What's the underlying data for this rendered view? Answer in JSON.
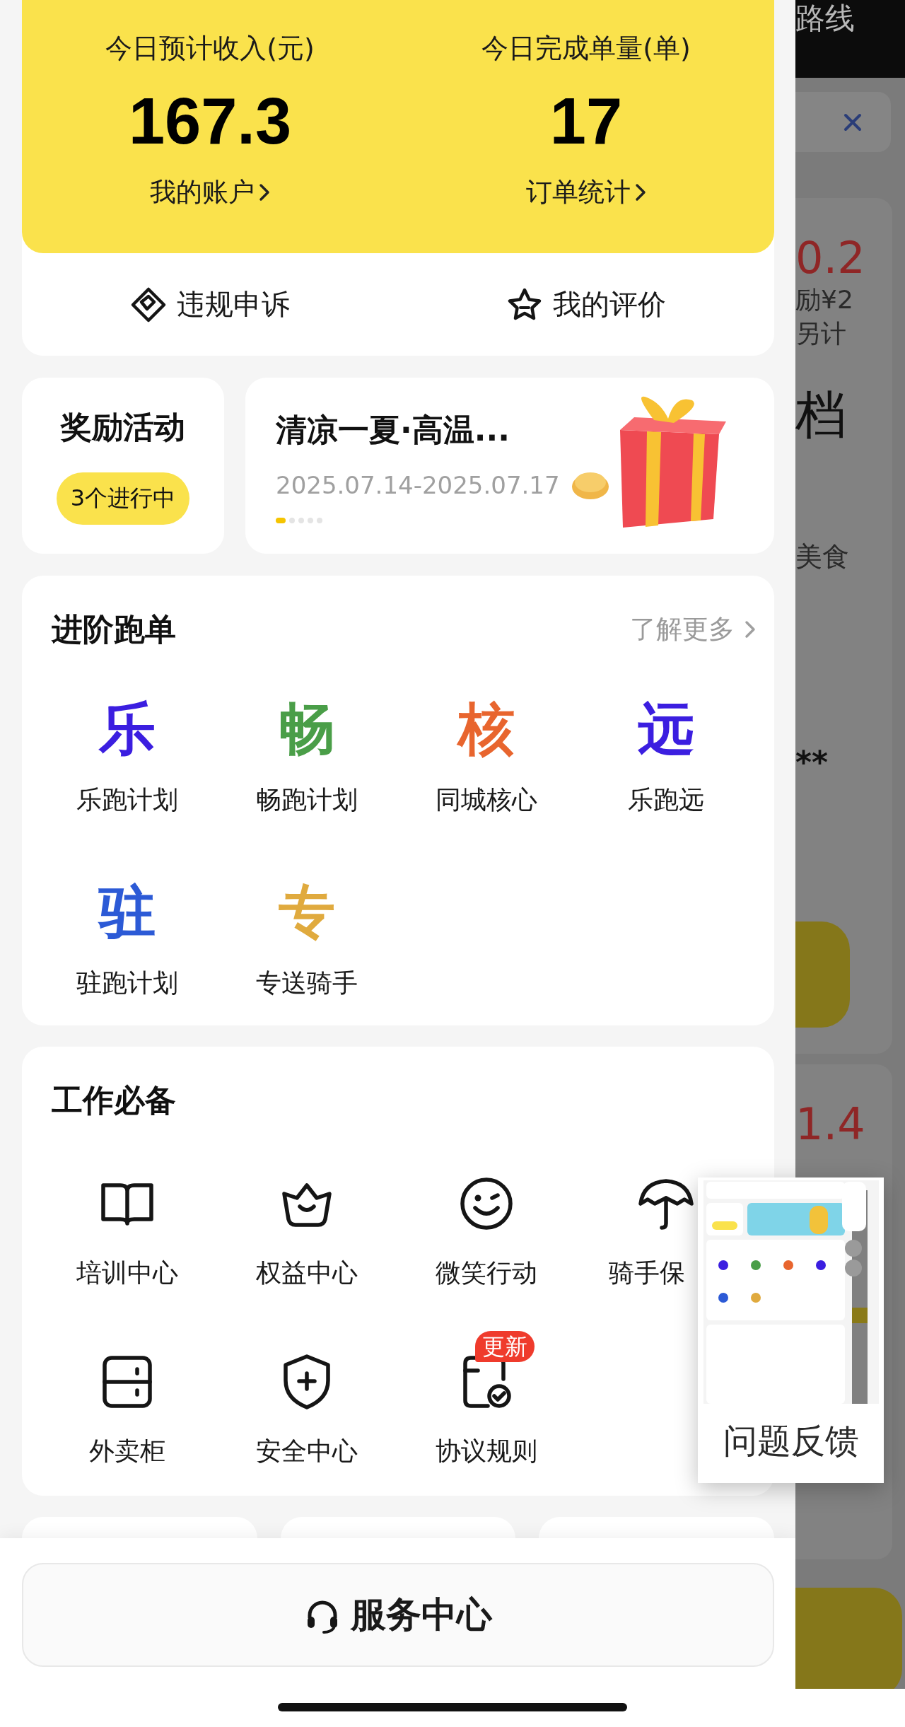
{
  "income_card": {
    "stats": [
      {
        "label": "今日预计收入(元)",
        "value": "167.3",
        "link": "我的账户"
      },
      {
        "label": "今日完成单量(单)",
        "value": "17",
        "link": "订单统计"
      }
    ]
  },
  "actions": [
    {
      "kind": "appeal",
      "label": "违规申诉"
    },
    {
      "kind": "rating",
      "label": "我的评价"
    }
  ],
  "rewards": {
    "title": "奖励活动",
    "badge": "3个进行中"
  },
  "banner": {
    "title": "清凉一夏·高温...",
    "dates": "2025.07.14-2025.07.17",
    "dots": [
      {
        "selected": true
      },
      {
        "selected": false
      },
      {
        "selected": false
      },
      {
        "selected": false
      },
      {
        "selected": false
      }
    ]
  },
  "advanced": {
    "title": "进阶跑单",
    "more": "了解更多",
    "items": [
      {
        "glyph": "乐",
        "color": "#3b1ee0",
        "label": "乐跑计划"
      },
      {
        "glyph": "畅",
        "color": "#4a9e48",
        "label": "畅跑计划"
      },
      {
        "glyph": "核",
        "color": "#e8652e",
        "label": "同城核心"
      },
      {
        "glyph": "远",
        "color": "#3b1ee0",
        "label": "乐跑远"
      },
      {
        "glyph": "驻",
        "color": "#2c5ad6",
        "label": "驻跑计划"
      },
      {
        "glyph": "专",
        "color": "#e0aa3e",
        "label": "专送骑手"
      }
    ]
  },
  "essentials": {
    "title": "工作必备",
    "items": [
      {
        "kind": "book",
        "label": "培训中心"
      },
      {
        "kind": "crown",
        "label": "权益中心"
      },
      {
        "kind": "smile",
        "label": "微笑行动"
      },
      {
        "kind": "umbrella",
        "label": "骑手保"
      },
      {
        "kind": "cabinet",
        "label": "外卖柜"
      },
      {
        "kind": "shield",
        "label": "安全中心"
      },
      {
        "kind": "document",
        "label": "协议规则",
        "badge": "更新"
      }
    ]
  },
  "service_button": {
    "label": "服务中心"
  },
  "background_page": {
    "title": "路线",
    "cards": [
      {
        "amount": "0.2",
        "notes": [
          "励¥2",
          "另计"
        ],
        "grade": "档",
        "tag": "美食",
        "masked": "**"
      },
      {
        "amount": "1.4"
      }
    ]
  },
  "feedback": {
    "label": "问题反馈"
  }
}
